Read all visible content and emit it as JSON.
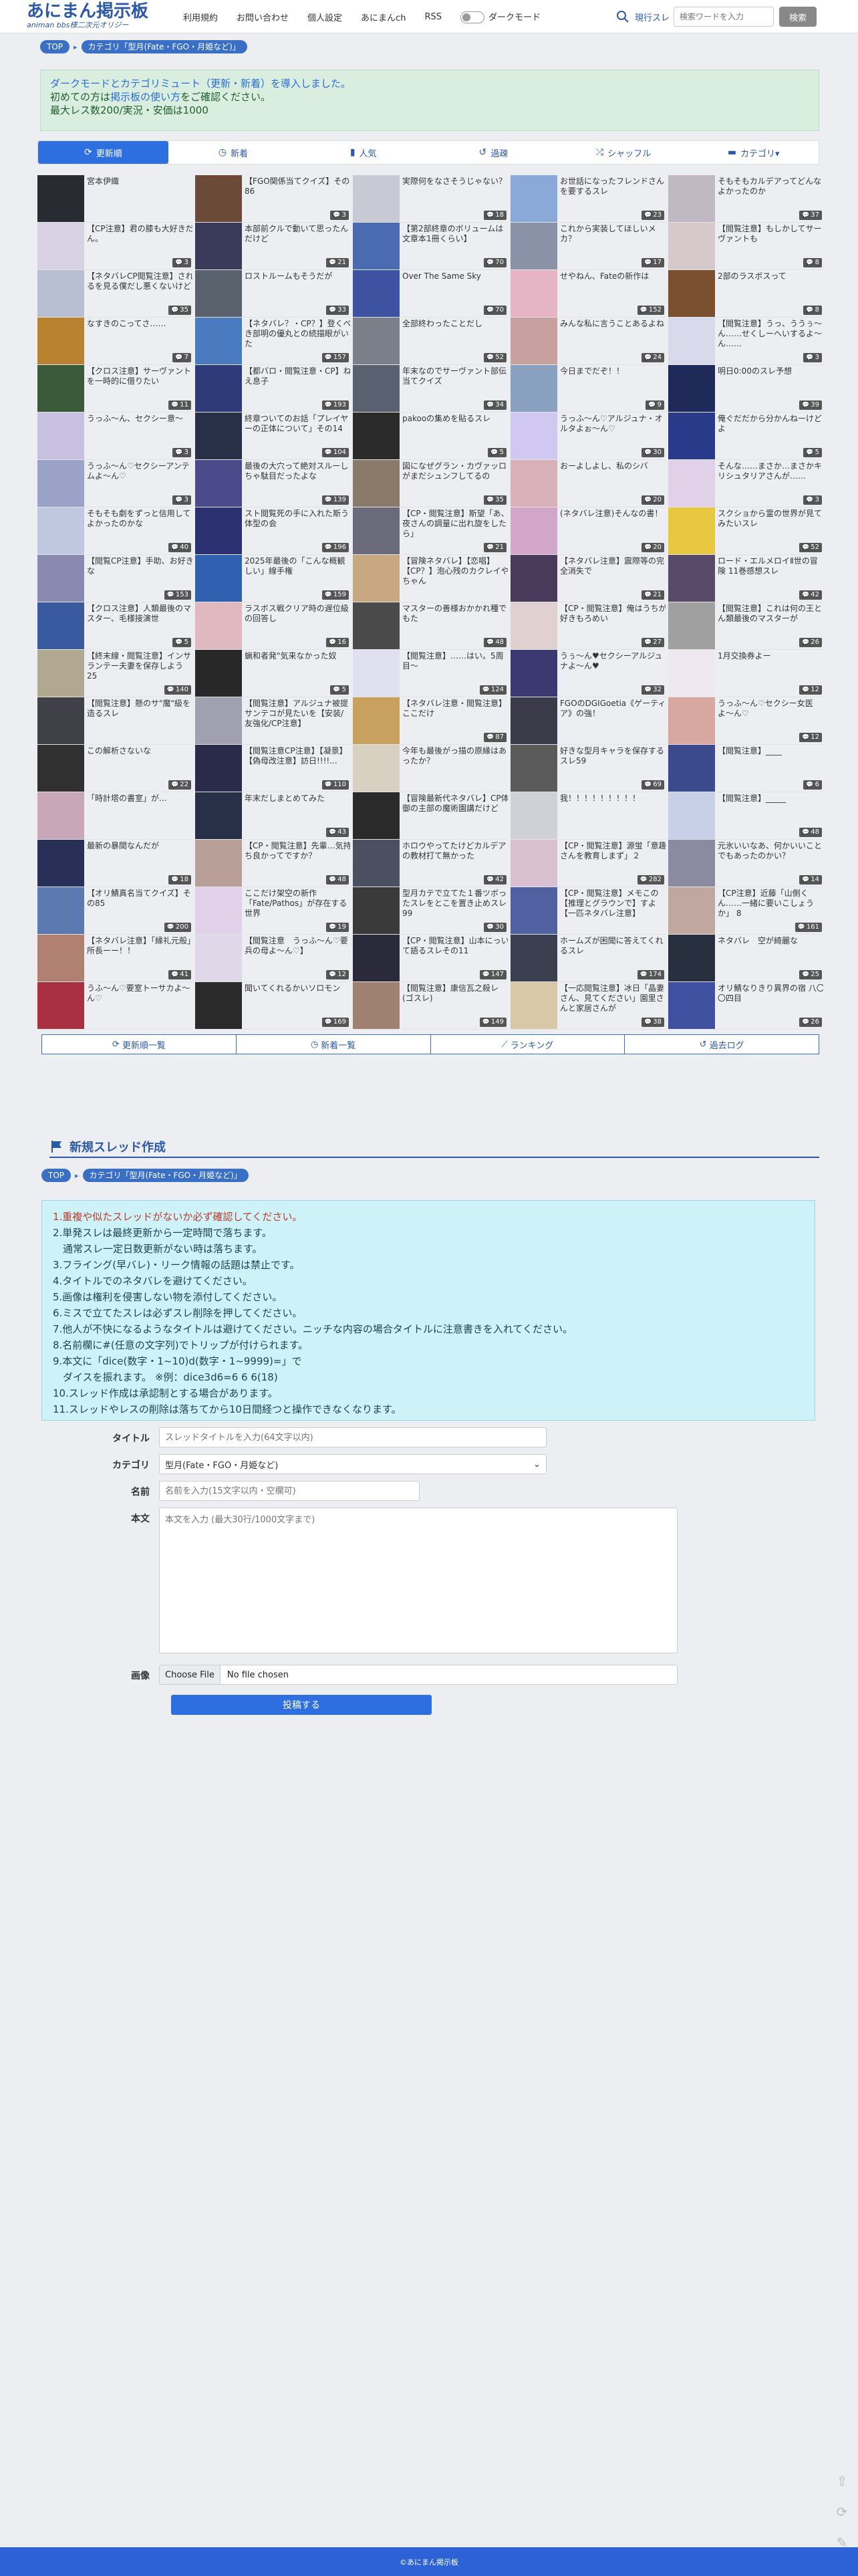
{
  "header": {
    "logo_main": "あにまん掲示板",
    "logo_sub": "animan bbs様二次元オリジー",
    "nav": [
      "利用規約",
      "お問い合わせ",
      "個人設定",
      "あにまんch",
      "RSS"
    ],
    "dark_mode_label": "ダークモード",
    "search_scope": "現行スレ",
    "search_placeholder": "検索ワードを入力",
    "search_button": "検索"
  },
  "breadcrumb": {
    "top": "TOP",
    "category": "カテゴリ「型月(Fate・FGO・月姫など)」"
  },
  "notice": {
    "line1": "ダークモードとカテゴリミュート（更新・新着）を導入しました。",
    "line2_pre": "初めての方は",
    "line2_link": "掲示板の使い方",
    "line2_post": "をご確認ください。",
    "line3": "最大レス数200/実況・安価は1000"
  },
  "tabs": [
    {
      "label": "更新順",
      "icon": "⟳",
      "active": true
    },
    {
      "label": "新着",
      "icon": "◷"
    },
    {
      "label": "人気",
      "icon": "▮"
    },
    {
      "label": "過疎",
      "icon": "↺"
    },
    {
      "label": "シャッフル",
      "icon": "⤮"
    },
    {
      "label": "カテゴリ▾",
      "icon": "▬"
    }
  ],
  "threads": [
    {
      "t": "宮本伊織",
      "c": "",
      "col": "#2a2a33"
    },
    {
      "t": "【FGO関係当てクイズ】その86",
      "c": "3",
      "col": "#6b4a3a"
    },
    {
      "t": "実際何をなさそうじゃない？",
      "c": "18",
      "col": "#c9c9d6"
    },
    {
      "t": "お世話になったフレンドさんを要するスレ",
      "c": "23",
      "col": "#8aa9d8"
    },
    {
      "t": "そもそもカルデアってどんなよかったのか",
      "c": "37",
      "col": "#c0b9c3"
    },
    {
      "t": "【CP注意】君の膝も大好きだん。",
      "c": "3",
      "col": "#d8d2e4"
    },
    {
      "t": "本部前クルで動いて思ったんだけど",
      "c": "21",
      "col": "#3a3a5a"
    },
    {
      "t": "【第2部終章のボリュームは文章本1冊くらい】",
      "c": "70",
      "col": "#4a6bb0"
    },
    {
      "t": "これから実装してほしいメカ？",
      "c": "17",
      "col": "#8a92a8"
    },
    {
      "t": "【閲覧注意】もしかしてサーヴァントも",
      "c": "8",
      "col": "#d5c9cc"
    },
    {
      "t": "【ネタバレCP閲覧注意】されるを見る僕だし悪くないけど",
      "c": "35",
      "col": "#b8bfd3"
    },
    {
      "t": "ロストルームもそうだが",
      "c": "33",
      "col": "#59626c"
    },
    {
      "t": "Over The Same Sky",
      "c": "70",
      "col": "#3d52a0"
    },
    {
      "t": "せやねん、Fateの新作は",
      "c": "152",
      "col": "#e6b5c5"
    },
    {
      "t": "2部のラスボスって",
      "c": "8",
      "col": "#7a5030"
    },
    {
      "t": "なすきのこってさ……",
      "c": "7",
      "col": "#b88230"
    },
    {
      "t": "【ネタバレ？・CP？】登くべき部明の優丸との続描眼がいた",
      "c": "157",
      "col": "#4a7ac0"
    },
    {
      "t": "全部終わったことだし",
      "c": "52",
      "col": "#7a7f8a"
    },
    {
      "t": "みんな私に言うことあるよね",
      "c": "24",
      "col": "#c8a0a0"
    },
    {
      "t": "【閲覧注意】うっ、ううぅ〜ん……せくしーへいするよ〜ん……",
      "c": "3",
      "col": "#d9d9ec"
    },
    {
      "t": "【クロス注意】サーヴァントを一時的に借りたい",
      "c": "11",
      "col": "#3b5a3a"
    },
    {
      "t": "【都バロ・閲覧注意・CP】ねえ息子",
      "c": "193",
      "col": "#2f3a78"
    },
    {
      "t": "年末なのでサーヴァント部伝当てクイズ",
      "c": "34",
      "col": "#596070"
    },
    {
      "t": "今日までだぞ！！",
      "c": "9",
      "col": "#8aa0c0"
    },
    {
      "t": "明日0:00のスレ予想",
      "c": "39",
      "col": "#1f2a58"
    },
    {
      "t": "うっふ〜ん、セクシー意〜",
      "c": "3",
      "col": "#c8c0e0"
    },
    {
      "t": "終章ついてのお話「プレイヤーの正体について」その14",
      "c": "104",
      "col": "#283048"
    },
    {
      "t": "pakooの集めを貼るスレ",
      "c": "5",
      "col": "#2a2a2a"
    },
    {
      "t": "うっふ〜ん♡アルジュナ・オルタよぉ〜ん♡",
      "c": "30",
      "col": "#d0c8f0"
    },
    {
      "t": "俺ぐだだから分かんねーけどよ",
      "c": "5",
      "col": "#2a3a8a"
    },
    {
      "t": "うっふ〜ん♡セクシーアンテムよ〜ん♡",
      "c": "3",
      "col": "#9aa2c8"
    },
    {
      "t": "最後の大穴って絶対スルーしちゃ駄目だったよな",
      "c": "139",
      "col": "#4a4a8a"
    },
    {
      "t": "図になぜグラン・カヴァッロがまだシュンフしてるの",
      "c": "35",
      "col": "#8a7a6a"
    },
    {
      "t": "おーよしよし、私のシバ",
      "c": "20",
      "col": "#d8b0b8"
    },
    {
      "t": "そんな……まさか…まさかキリシュタリアさんが……",
      "c": "3",
      "col": "#e0d0e8"
    },
    {
      "t": "そもそも劇をずっと信用してよかったのかな",
      "c": "40",
      "col": "#c0c8e0"
    },
    {
      "t": "スト閲覧死の手に入れた斯う体型の会",
      "c": "196",
      "col": "#2a3070"
    },
    {
      "t": "【CP・閲覧注意】斯望「あ、夜さんの調量に出れ旋をしたら」",
      "c": "21",
      "col": "#6a6a7a"
    },
    {
      "t": "(ネタバレ注意)そんなの書！",
      "c": "20",
      "col": "#d2a6c8"
    },
    {
      "t": "スクショから霊の世界が見てみたいスレ",
      "c": "52",
      "col": "#e8c840"
    },
    {
      "t": "【閲覧CP注意】手助、お好きな",
      "c": "153",
      "col": "#8a8ab0"
    },
    {
      "t": "2025年最後の「こんな概観しい」線手権",
      "c": "159",
      "col": "#3060b0"
    },
    {
      "t": "【冒険ネタバレ】【恋唱】【CP？】泡心残のカクレイやちゃん",
      "c": "",
      "col": "#c8a880"
    },
    {
      "t": "【ネタバレ注意】震際等の完全消失で",
      "c": "21",
      "col": "#4a3a5a"
    },
    {
      "t": "ロード・エルメロイⅡ世の冒険 11巻感想スレ",
      "c": "42",
      "col": "#5a4a6a"
    },
    {
      "t": "【クロス注意】人類最後のマスター、毛様接演世",
      "c": "5",
      "col": "#3a5aa0"
    },
    {
      "t": "ラスボス戦クリア時の遅位級の回答し",
      "c": "16",
      "col": "#e0b8c0"
    },
    {
      "t": "マスターの善様おかかれ種でもた",
      "c": "48",
      "col": "#4a4a4a"
    },
    {
      "t": "【CP・閲覧注意】俺はうちが好きもろめい",
      "c": "27",
      "col": "#e0d0d0"
    },
    {
      "t": "【閲覧注意】これは何の王とん類最後のマスターが",
      "c": "26",
      "col": "#a0a0a0"
    },
    {
      "t": "【終末線・閲覧注意】インサランテー夫妻を保存しよう 25",
      "c": "140",
      "col": "#b0a890"
    },
    {
      "t": "蝋和者発\"気来なかった奴",
      "c": "5",
      "col": "#282828"
    },
    {
      "t": "【閲覧注意】……はい。5周目〜",
      "c": "124",
      "col": "#e0e0f0"
    },
    {
      "t": "うぅ〜ん♥セクシーアルジュナよ〜ん♥",
      "c": "32",
      "col": "#3a3a70"
    },
    {
      "t": "1月交換券よー",
      "c": "12",
      "col": "#f0e8f0"
    },
    {
      "t": "【閲覧注意】懸のサ\"魔\"級を造るスレ",
      "c": "",
      "col": "#404048"
    },
    {
      "t": "【閲覧注意】アルジュナ被提サンテコが見たいを【安装/友強化/CP注意】",
      "c": "",
      "col": "#a0a0b0"
    },
    {
      "t": "【ネタバレ注意・閲覧注意】ここだけ",
      "c": "87",
      "col": "#c8a060"
    },
    {
      "t": "FGOのDGIGoetia《ゲーティア》の強！",
      "c": "",
      "col": "#3a3a48"
    },
    {
      "t": "うっふ〜ん♡セクシー女医よ〜ん♡",
      "c": "12",
      "col": "#d8a8a0"
    },
    {
      "t": "この解析さないな",
      "c": "22",
      "col": "#303030"
    },
    {
      "t": "【閲覧注意CP注意】【凝景】【偽母改注意】訪日!!!!...",
      "c": "110",
      "col": "#2a2a4a"
    },
    {
      "t": "今年も最後がっ描の原縁はあったか？",
      "c": "",
      "col": "#d8d0c0"
    },
    {
      "t": "好きな型月キャラを保存するスレ59",
      "c": "69",
      "col": "#5a5a5a"
    },
    {
      "t": "【閲覧注意】____",
      "c": "6",
      "col": "#3a4a8a"
    },
    {
      "t": "「時計塔の書室」が...",
      "c": "",
      "col": "#c8a8b8"
    },
    {
      "t": "年末だしまとめてみた",
      "c": "43",
      "col": "#283048"
    },
    {
      "t": "【冒険最新代ネタバレ】CP体御の主部の魔術園講だけど",
      "c": "",
      "col": "#2a2a2a"
    },
    {
      "t": "我！！！！！！！！！",
      "c": "",
      "col": "#d0d0d8"
    },
    {
      "t": "【閲覧注意】_____",
      "c": "48",
      "col": "#c8d0e8"
    },
    {
      "t": "最新の暴間なんだが",
      "c": "18",
      "col": "#283058"
    },
    {
      "t": "【CP・閲覧注意】先輩…気持ち良かってですか？",
      "c": "48",
      "col": "#b8a098"
    },
    {
      "t": "ホロウやってたけどカルデアの教材打て無かった",
      "c": "42",
      "col": "#4a5060"
    },
    {
      "t": "【CP・閲覧注意】源蛍「意趣さんを教育しまず」２",
      "c": "282",
      "col": "#d8c0d0"
    },
    {
      "t": "元氷いいなあ、何かいいことでもあったのかい？",
      "c": "14",
      "col": "#8a8aa0"
    },
    {
      "t": "【オリ鯖真名当てクイズ】その85",
      "c": "200",
      "col": "#5a7ab0"
    },
    {
      "t": "ここだけ架空の新作「Fate/Pathos」が存在する世界",
      "c": "19",
      "col": "#e0d0e8"
    },
    {
      "t": "型月カテで立てた１番ツボったスレをとこを置き止めスレ99",
      "c": "30",
      "col": "#3a3a3a"
    },
    {
      "t": "【CP・閲覧注意】メモこの【推理とグラウンで】すよ【一匹ネタバレ注意】",
      "c": "",
      "col": "#5060a0"
    },
    {
      "t": "【CP注意】近藤「山側くん……一緒に要いこしょうか」 8",
      "c": "161",
      "col": "#c0a8a0"
    },
    {
      "t": "【ネタバレ注意】「縁礼元般」所長ーー！！",
      "c": "41",
      "col": "#b08070"
    },
    {
      "t": "【閲覧注意　うっふ〜ん♡要兵の母よ〜ん♡】",
      "c": "12",
      "col": "#e0d8e8"
    },
    {
      "t": "【CP・閲覧注意】山本にっいて語るスレその11",
      "c": "147",
      "col": "#2a2a3a"
    },
    {
      "t": "ホームズが困聞に答えてくれるスレ",
      "c": "174",
      "col": "#3a4050"
    },
    {
      "t": "ネタバレ　空が綺麗な",
      "c": "25",
      "col": "#283040"
    },
    {
      "t": "うふ〜ん♡要室トーサカよ〜ん♡",
      "c": "",
      "col": "#a83040"
    },
    {
      "t": "聞いてくれるかいソロモン",
      "c": "169",
      "col": "#2a2a2a"
    },
    {
      "t": "【閲覧注意】康信瓦之殺レ(ゴスレ)",
      "c": "149",
      "col": "#a08070"
    },
    {
      "t": "【一応閲覧注意】冰日「晶妻さん、見てください」園里さんと家居さんが",
      "c": "38",
      "col": "#d8c8a8"
    },
    {
      "t": "オリ鯖なりきり異界の宿 八〇〇四目",
      "c": "26",
      "col": "#4050a0"
    }
  ],
  "bottom_links": [
    {
      "label": "更新順一覧",
      "icon": "⟳"
    },
    {
      "label": "新着一覧",
      "icon": "◷"
    },
    {
      "label": "ランキング",
      "icon": "⟋"
    },
    {
      "label": "過去ログ",
      "icon": "↺"
    }
  ],
  "new_thread": {
    "title": "新規スレッド作成",
    "breadcrumb_top": "TOP",
    "breadcrumb_category": "カテゴリ「型月(Fate・FGO・月姫など)」",
    "rules": [
      "1.重複や似たスレッドがないか必ず確認してください。",
      "2.単発スレは最終更新から一定時間で落ちます。",
      "　通常スレ一定日数更新がない時は落ちます。",
      "3.フライング(早バレ)・リーク情報の話題は禁止です。",
      "4.タイトルでのネタバレを避けてください。",
      "5.画像は権利を侵害しない物を添付してください。",
      "6.ミスで立てたスレは必ずスレ削除を押してください。",
      "7.他人が不快になるようなタイトルは避けてください。ニッチな内容の場合タイトルに注意書きを入れてください。",
      "8.名前欄に#(任意の文字列)でトリップが付けられます。",
      "9.本文に「dice(数字・1~10)d(数字・1~9999)=」で",
      "　ダイスを振れます。 ※例：dice3d6=6 6 6(18)",
      "10.スレッド作成は承認制とする場合があります。",
      "11.スレッドやレスの削除は落ちてから10日間経つと操作できなくなります。"
    ],
    "labels": {
      "title": "タイトル",
      "category": "カテゴリ",
      "name": "名前",
      "body": "本文",
      "image": "画像"
    },
    "placeholders": {
      "title": "スレッドタイトルを入力(64文字以内)",
      "name": "名前を入力(15文字以内・空欄可)",
      "body": "本文を入力 (最大30行/1000文字まで)"
    },
    "category_value": "型月(Fate・FGO・月姫など)",
    "file_button": "Choose File",
    "file_status": "No file chosen",
    "submit": "投稿する"
  },
  "footer": "©あにまん掲示板"
}
